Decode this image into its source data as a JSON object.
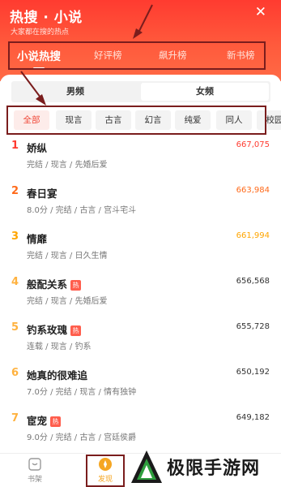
{
  "header": {
    "brand": "热搜 · 小说",
    "slogan": "大家都在搜的热点",
    "tabs": [
      "小说热搜",
      "好评榜",
      "飙升榜",
      "新书榜"
    ]
  },
  "gender": [
    "男频",
    "女频"
  ],
  "filters": [
    "全部",
    "现言",
    "古言",
    "幻言",
    "纯爱",
    "同人",
    "校园"
  ],
  "rank_colors": [
    "#ff3b30",
    "#ff6a1a",
    "#ffa500",
    "#ffb23f",
    "#ffb23f",
    "#ffb23f",
    "#ffb23f"
  ],
  "list": [
    {
      "rank": "1",
      "title": "娇纵",
      "hot": false,
      "meta": "完结 / 现言 / 先婚后爱",
      "score": "667,075",
      "score_color": "#ff3b30"
    },
    {
      "rank": "2",
      "title": "春日宴",
      "hot": false,
      "meta": "8.0分 / 完结 / 古言 / 宫斗宅斗",
      "score": "663,984",
      "score_color": "#ff6a1a"
    },
    {
      "rank": "3",
      "title": "情靡",
      "hot": false,
      "meta": "完结 / 现言 / 日久生情",
      "score": "661,994",
      "score_color": "#ffa500"
    },
    {
      "rank": "4",
      "title": "般配关系",
      "hot": true,
      "meta": "完结 / 现言 / 先婚后爱",
      "score": "656,568",
      "score_color": "#333333"
    },
    {
      "rank": "5",
      "title": "钓系玫瑰",
      "hot": true,
      "meta": "连载 / 现言 / 钓系",
      "score": "655,728",
      "score_color": "#333333"
    },
    {
      "rank": "6",
      "title": "她真的很难追",
      "hot": false,
      "meta": "7.0分 / 完结 / 现言 / 情有独钟",
      "score": "650,192",
      "score_color": "#333333"
    },
    {
      "rank": "7",
      "title": "宦宠",
      "hot": true,
      "meta": "9.0分 / 完结 / 古言 / 宫廷侯爵",
      "score": "649,182",
      "score_color": "#333333"
    }
  ],
  "hot_badge": "热",
  "bottom_nav": [
    "书架",
    "发现"
  ],
  "watermark": "极限手游网"
}
